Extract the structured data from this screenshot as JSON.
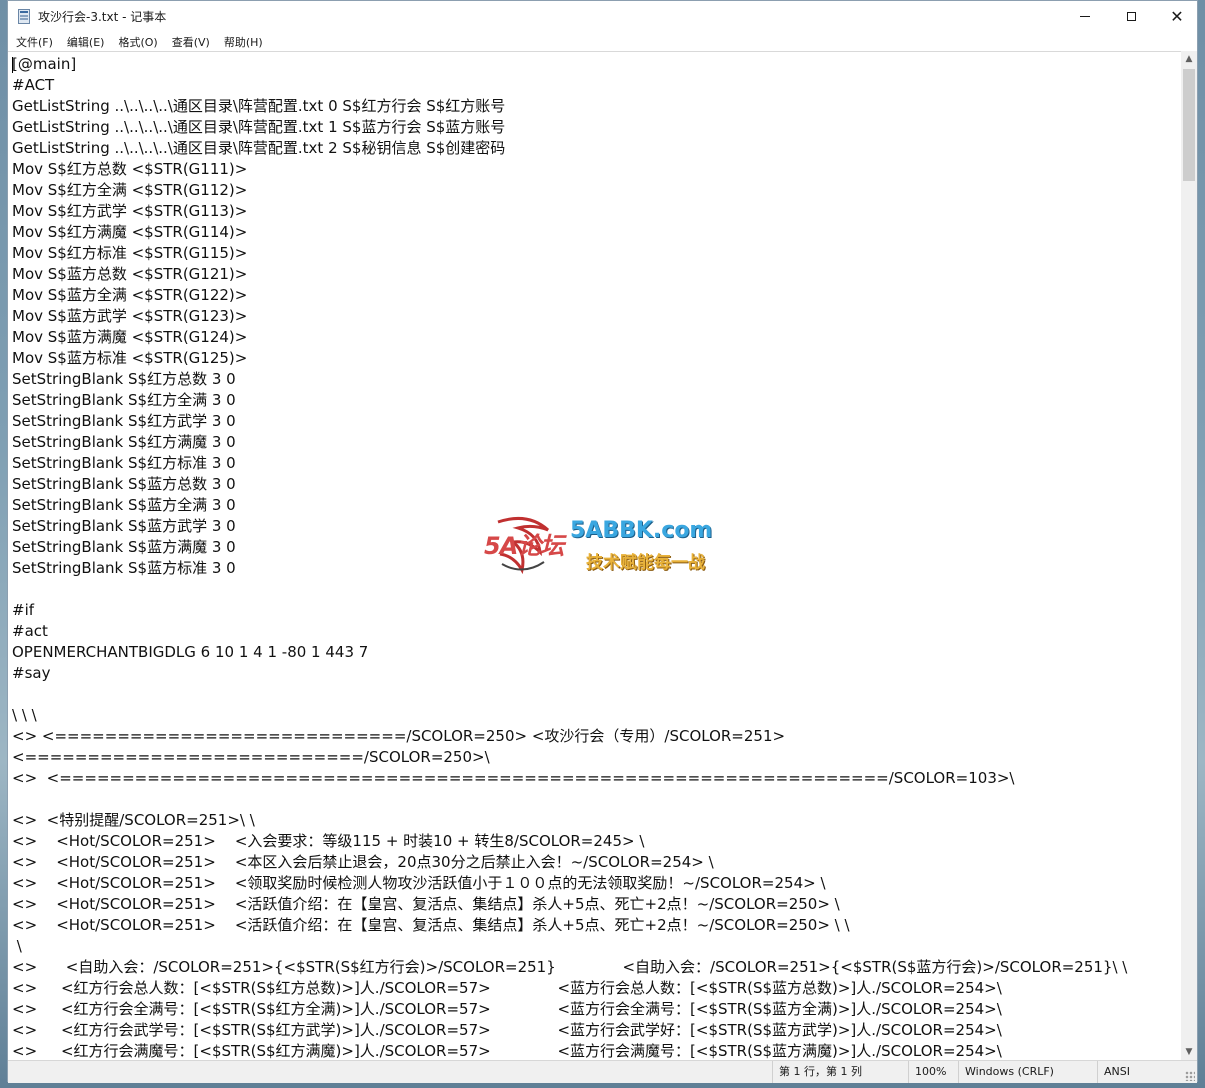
{
  "window": {
    "title": "攻沙行会-3.txt - 记事本",
    "icon": "notepad-icon"
  },
  "menu": [
    "文件(F)",
    "编辑(E)",
    "格式(O)",
    "查看(V)",
    "帮助(H)"
  ],
  "editor": {
    "lines": [
      "[@main]",
      "#ACT",
      "GetListString ..\\..\\..\\..\\通区目录\\阵营配置.txt 0 S$红方行会 S$红方账号",
      "GetListString ..\\..\\..\\..\\通区目录\\阵营配置.txt 1 S$蓝方行会 S$蓝方账号",
      "GetListString ..\\..\\..\\..\\通区目录\\阵营配置.txt 2 S$秘钥信息 S$创建密码",
      "Mov S$红方总数 <$STR(G111)>",
      "Mov S$红方全满 <$STR(G112)>",
      "Mov S$红方武学 <$STR(G113)>",
      "Mov S$红方满魔 <$STR(G114)>",
      "Mov S$红方标准 <$STR(G115)>",
      "Mov S$蓝方总数 <$STR(G121)>",
      "Mov S$蓝方全满 <$STR(G122)>",
      "Mov S$蓝方武学 <$STR(G123)>",
      "Mov S$蓝方满魔 <$STR(G124)>",
      "Mov S$蓝方标准 <$STR(G125)>",
      "SetStringBlank S$红方总数 3 0",
      "SetStringBlank S$红方全满 3 0",
      "SetStringBlank S$红方武学 3 0",
      "SetStringBlank S$红方满魔 3 0",
      "SetStringBlank S$红方标准 3 0",
      "SetStringBlank S$蓝方总数 3 0",
      "SetStringBlank S$蓝方全满 3 0",
      "SetStringBlank S$蓝方武学 3 0",
      "SetStringBlank S$蓝方满魔 3 0",
      "SetStringBlank S$蓝方标准 3 0",
      "",
      "#if",
      "#act",
      "OPENMERCHANTBIGDLG 6 10 1 4 1 -80 1 443 7",
      "#say",
      "",
      "\\ \\ \\",
      "<> <============================/SCOLOR=250> <攻沙行会（专用）/SCOLOR=251>",
      "<===========================/SCOLOR=250>\\",
      "<>  <==================================================================/SCOLOR=103>\\",
      "",
      "<>  <特别提醒/SCOLOR=251>\\ \\",
      "<>    <Hot/SCOLOR=251>    <入会要求：等级115 + 时装10 + 转生8/SCOLOR=245> \\",
      "<>    <Hot/SCOLOR=251>    <本区入会后禁止退会，20点30分之后禁止入会！~/SCOLOR=254> \\",
      "<>    <Hot/SCOLOR=251>    <领取奖励时候检测人物攻沙活跃值小于１００点的无法领取奖励！~/SCOLOR=254> \\",
      "<>    <Hot/SCOLOR=251>    <活跃值介绍：在【皇宫、复活点、集结点】杀人+5点、死亡+2点！~/SCOLOR=250> \\",
      "<>    <Hot/SCOLOR=251>    <活跃值介绍：在【皇宫、复活点、集结点】杀人+5点、死亡+2点！~/SCOLOR=250> \\ \\",
      " \\",
      "<>      <自助入会：/SCOLOR=251>{<$STR(S$红方行会)>/SCOLOR=251}              <自助入会：/SCOLOR=251>{<$STR(S$蓝方行会)>/SCOLOR=251}\\ \\",
      "<>     <红方行会总人数：[<$STR(S$红方总数)>]人./SCOLOR=57>              <蓝方行会总人数：[<$STR(S$蓝方总数)>]人./SCOLOR=254>\\",
      "<>     <红方行会全满号：[<$STR(S$红方全满)>]人./SCOLOR=57>              <蓝方行会全满号：[<$STR(S$蓝方全满)>]人./SCOLOR=254>\\",
      "<>     <红方行会武学号：[<$STR(S$红方武学)>]人./SCOLOR=57>              <蓝方行会武学好：[<$STR(S$蓝方武学)>]人./SCOLOR=254>\\",
      "<>     <红方行会满魔号：[<$STR(S$红方满魔)>]人./SCOLOR=57>              <蓝方行会满魔号：[<$STR(S$蓝方满魔)>]人./SCOLOR=254>\\"
    ]
  },
  "status": {
    "position": "第 1 行，第 1 列",
    "zoom": "100%",
    "line_ending": "Windows (CRLF)",
    "encoding": "ANSI"
  },
  "watermark": {
    "logo": "5A论坛",
    "site": "5ABBK.com",
    "slogan": "技术赋能每一战"
  }
}
